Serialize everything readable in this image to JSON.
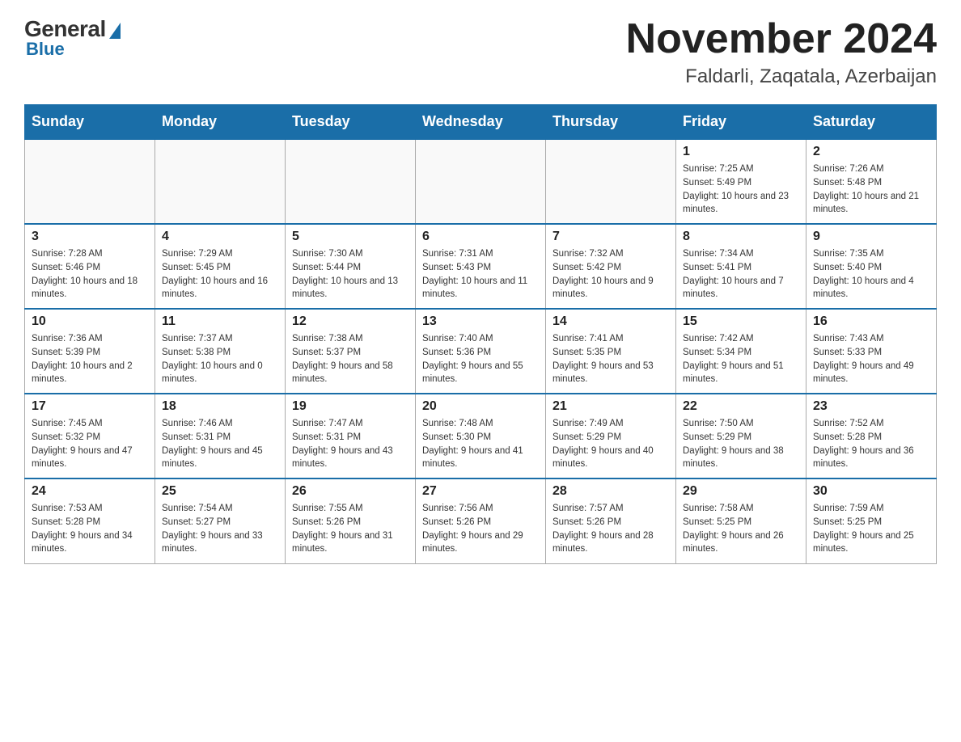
{
  "header": {
    "logo_general": "General",
    "logo_blue": "Blue",
    "month_year": "November 2024",
    "location": "Faldarli, Zaqatala, Azerbaijan"
  },
  "days_of_week": [
    "Sunday",
    "Monday",
    "Tuesday",
    "Wednesday",
    "Thursday",
    "Friday",
    "Saturday"
  ],
  "weeks": [
    [
      {
        "day": "",
        "info": ""
      },
      {
        "day": "",
        "info": ""
      },
      {
        "day": "",
        "info": ""
      },
      {
        "day": "",
        "info": ""
      },
      {
        "day": "",
        "info": ""
      },
      {
        "day": "1",
        "info": "Sunrise: 7:25 AM\nSunset: 5:49 PM\nDaylight: 10 hours and 23 minutes."
      },
      {
        "day": "2",
        "info": "Sunrise: 7:26 AM\nSunset: 5:48 PM\nDaylight: 10 hours and 21 minutes."
      }
    ],
    [
      {
        "day": "3",
        "info": "Sunrise: 7:28 AM\nSunset: 5:46 PM\nDaylight: 10 hours and 18 minutes."
      },
      {
        "day": "4",
        "info": "Sunrise: 7:29 AM\nSunset: 5:45 PM\nDaylight: 10 hours and 16 minutes."
      },
      {
        "day": "5",
        "info": "Sunrise: 7:30 AM\nSunset: 5:44 PM\nDaylight: 10 hours and 13 minutes."
      },
      {
        "day": "6",
        "info": "Sunrise: 7:31 AM\nSunset: 5:43 PM\nDaylight: 10 hours and 11 minutes."
      },
      {
        "day": "7",
        "info": "Sunrise: 7:32 AM\nSunset: 5:42 PM\nDaylight: 10 hours and 9 minutes."
      },
      {
        "day": "8",
        "info": "Sunrise: 7:34 AM\nSunset: 5:41 PM\nDaylight: 10 hours and 7 minutes."
      },
      {
        "day": "9",
        "info": "Sunrise: 7:35 AM\nSunset: 5:40 PM\nDaylight: 10 hours and 4 minutes."
      }
    ],
    [
      {
        "day": "10",
        "info": "Sunrise: 7:36 AM\nSunset: 5:39 PM\nDaylight: 10 hours and 2 minutes."
      },
      {
        "day": "11",
        "info": "Sunrise: 7:37 AM\nSunset: 5:38 PM\nDaylight: 10 hours and 0 minutes."
      },
      {
        "day": "12",
        "info": "Sunrise: 7:38 AM\nSunset: 5:37 PM\nDaylight: 9 hours and 58 minutes."
      },
      {
        "day": "13",
        "info": "Sunrise: 7:40 AM\nSunset: 5:36 PM\nDaylight: 9 hours and 55 minutes."
      },
      {
        "day": "14",
        "info": "Sunrise: 7:41 AM\nSunset: 5:35 PM\nDaylight: 9 hours and 53 minutes."
      },
      {
        "day": "15",
        "info": "Sunrise: 7:42 AM\nSunset: 5:34 PM\nDaylight: 9 hours and 51 minutes."
      },
      {
        "day": "16",
        "info": "Sunrise: 7:43 AM\nSunset: 5:33 PM\nDaylight: 9 hours and 49 minutes."
      }
    ],
    [
      {
        "day": "17",
        "info": "Sunrise: 7:45 AM\nSunset: 5:32 PM\nDaylight: 9 hours and 47 minutes."
      },
      {
        "day": "18",
        "info": "Sunrise: 7:46 AM\nSunset: 5:31 PM\nDaylight: 9 hours and 45 minutes."
      },
      {
        "day": "19",
        "info": "Sunrise: 7:47 AM\nSunset: 5:31 PM\nDaylight: 9 hours and 43 minutes."
      },
      {
        "day": "20",
        "info": "Sunrise: 7:48 AM\nSunset: 5:30 PM\nDaylight: 9 hours and 41 minutes."
      },
      {
        "day": "21",
        "info": "Sunrise: 7:49 AM\nSunset: 5:29 PM\nDaylight: 9 hours and 40 minutes."
      },
      {
        "day": "22",
        "info": "Sunrise: 7:50 AM\nSunset: 5:29 PM\nDaylight: 9 hours and 38 minutes."
      },
      {
        "day": "23",
        "info": "Sunrise: 7:52 AM\nSunset: 5:28 PM\nDaylight: 9 hours and 36 minutes."
      }
    ],
    [
      {
        "day": "24",
        "info": "Sunrise: 7:53 AM\nSunset: 5:28 PM\nDaylight: 9 hours and 34 minutes."
      },
      {
        "day": "25",
        "info": "Sunrise: 7:54 AM\nSunset: 5:27 PM\nDaylight: 9 hours and 33 minutes."
      },
      {
        "day": "26",
        "info": "Sunrise: 7:55 AM\nSunset: 5:26 PM\nDaylight: 9 hours and 31 minutes."
      },
      {
        "day": "27",
        "info": "Sunrise: 7:56 AM\nSunset: 5:26 PM\nDaylight: 9 hours and 29 minutes."
      },
      {
        "day": "28",
        "info": "Sunrise: 7:57 AM\nSunset: 5:26 PM\nDaylight: 9 hours and 28 minutes."
      },
      {
        "day": "29",
        "info": "Sunrise: 7:58 AM\nSunset: 5:25 PM\nDaylight: 9 hours and 26 minutes."
      },
      {
        "day": "30",
        "info": "Sunrise: 7:59 AM\nSunset: 5:25 PM\nDaylight: 9 hours and 25 minutes."
      }
    ]
  ]
}
